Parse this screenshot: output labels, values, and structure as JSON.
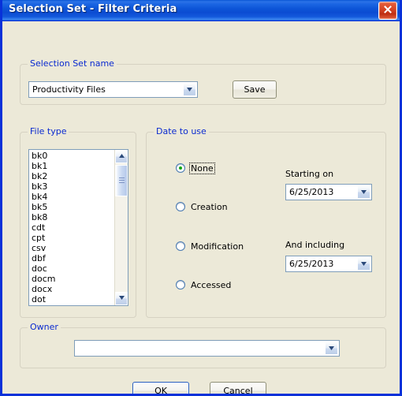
{
  "window": {
    "title": "Selection Set - Filter Criteria",
    "close_icon": "close-x-icon",
    "title_bar_color": "#0a56d6",
    "body_color": "#ece9d8"
  },
  "selection_set": {
    "group_label": "Selection Set name",
    "combo_value": "Productivity Files",
    "save_label": "Save"
  },
  "file_type": {
    "group_label": "File type",
    "items": [
      "bk0",
      "bk1",
      "bk2",
      "bk3",
      "bk4",
      "bk5",
      "bk8",
      "cdt",
      "cpt",
      "csv",
      "dbf",
      "doc",
      "docm",
      "docx",
      "dot"
    ]
  },
  "date_to_use": {
    "group_label": "Date to use",
    "options": [
      {
        "label": "None",
        "checked": true,
        "focused": true
      },
      {
        "label": "Creation",
        "checked": false,
        "focused": false
      },
      {
        "label": "Modification",
        "checked": false,
        "focused": false
      },
      {
        "label": "Accessed",
        "checked": false,
        "focused": false
      }
    ],
    "starting_on_label": "Starting on",
    "starting_on_value": "6/25/2013",
    "and_including_label": "And including",
    "and_including_value": "6/25/2013"
  },
  "owner": {
    "group_label": "Owner",
    "combo_value": ""
  },
  "footer": {
    "ok_label": "OK",
    "cancel_label": "Cancel"
  }
}
